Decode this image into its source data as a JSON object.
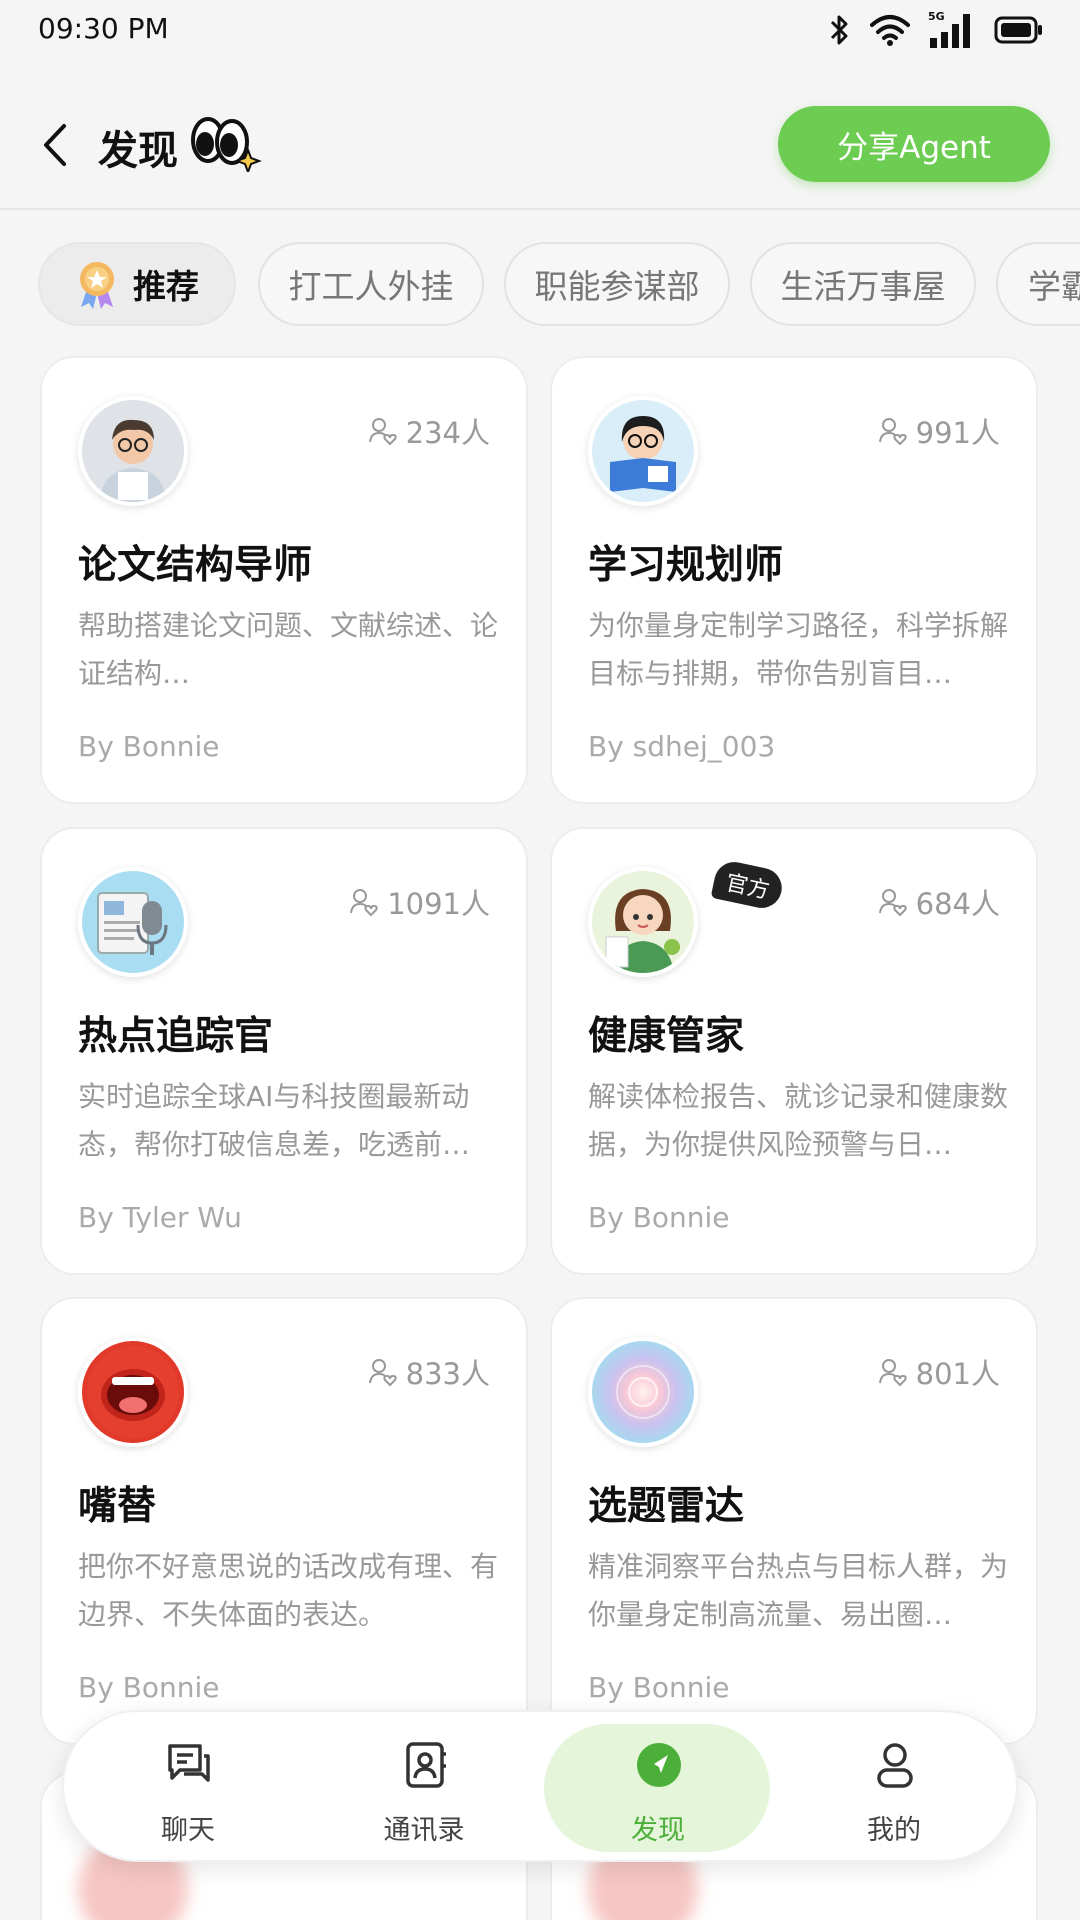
{
  "status_bar": {
    "time": "09:30 PM",
    "network": "5G"
  },
  "header": {
    "title": "发现",
    "share_button": "分享Agent"
  },
  "tabs": [
    {
      "label": "推荐",
      "active": true
    },
    {
      "label": "打工人外挂",
      "active": false
    },
    {
      "label": "职能参谋部",
      "active": false
    },
    {
      "label": "生活万事屋",
      "active": false
    },
    {
      "label": "学霸",
      "active": false
    }
  ],
  "cards": [
    {
      "count": "234人",
      "title": "论文结构导师",
      "desc": "帮助搭建论文问题、文献综述、论证结构…",
      "author": "By Bonnie",
      "avatar": "scholar-avatar"
    },
    {
      "count": "991人",
      "title": "学习规划师",
      "desc": "为你量身定制学习路径，科学拆解目标与排期，带你告别盲目…",
      "author": "By sdhej_003",
      "avatar": "student-avatar"
    },
    {
      "count": "1091人",
      "title": "热点追踪官",
      "desc": "实时追踪全球AI与科技圈最新动态，帮你打破信息差，吃透前…",
      "author": "By Tyler Wu",
      "avatar": "newspaper-mic-avatar"
    },
    {
      "count": "684人",
      "title": "健康管家",
      "desc": "解读体检报告、就诊记录和健康数据，为你提供风险预警与日…",
      "author": "By Bonnie",
      "avatar": "health-girl-avatar",
      "badge": "官方"
    },
    {
      "count": "833人",
      "title": "嘴替",
      "desc": "把你不好意思说的话改成有理、有边界、不失体面的表达。",
      "author": "By Bonnie",
      "avatar": "mouth-avatar"
    },
    {
      "count": "801人",
      "title": "选题雷达",
      "desc": "精准洞察平台热点与目标人群，为你量身定制高流量、易出圈…",
      "author": "By Bonnie",
      "avatar": "radar-orb-avatar"
    }
  ],
  "bottom_nav": [
    {
      "label": "聊天",
      "icon": "chat-icon",
      "active": false
    },
    {
      "label": "通讯录",
      "icon": "contacts-icon",
      "active": false
    },
    {
      "label": "发现",
      "icon": "discover-icon",
      "active": true
    },
    {
      "label": "我的",
      "icon": "profile-icon",
      "active": false
    }
  ],
  "colors": {
    "accent": "#6dcc52",
    "nav_active_bg": "#e4f5d9",
    "nav_active_text": "#4caf3a"
  }
}
